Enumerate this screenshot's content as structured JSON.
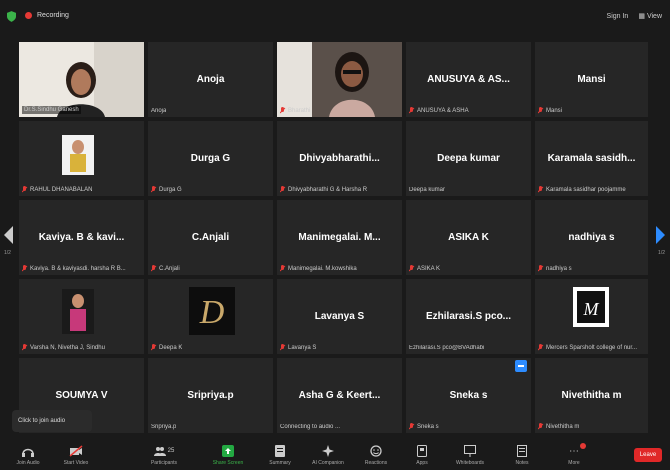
{
  "header": {
    "recording_label": "Recording",
    "signin": "Sign In",
    "view": "View"
  },
  "tiles": [
    {
      "name": "",
      "label": "Dr.S.Sindhu Ganesh"
    },
    {
      "name": "Anoja",
      "label": "Anoja"
    },
    {
      "name": "",
      "label": "Bharathi"
    },
    {
      "name": "ANUSUYA & AS...",
      "label": "ANUSUYA & ASHA"
    },
    {
      "name": "Mansi",
      "label": "Mansi"
    },
    {
      "name": "",
      "label": "RAHUL DHANABALAN"
    },
    {
      "name": "Durga G",
      "label": "Durga G"
    },
    {
      "name": "Dhivyabharathi...",
      "label": "Dhivyabharathi G & Harsha R"
    },
    {
      "name": "Deepa kumar",
      "label": "Deepa kumar"
    },
    {
      "name": "Karamala sasidh...",
      "label": "Karamala sasidhar poojamme"
    },
    {
      "name": "Kaviya. B & kavi...",
      "label": "Kaviya. B & kaviyasdi. harsha R B..."
    },
    {
      "name": "C.Anjali",
      "label": "C.Anjali"
    },
    {
      "name": "Manimegalai. M...",
      "label": "Manimegalai. M.kowshika"
    },
    {
      "name": "ASIKA K",
      "label": "ASIKA K"
    },
    {
      "name": "nadhiya s",
      "label": "nadhiya s"
    },
    {
      "name": "",
      "label": "Varsha N, Nivetha J, Sindhu"
    },
    {
      "name": "",
      "label": "Deepa K"
    },
    {
      "name": "Lavanya S",
      "label": "Lavanya S"
    },
    {
      "name": "Ezhilarasi.S pco...",
      "label": "Ezhilarasi.S pco@BVAdhabi"
    },
    {
      "name": "",
      "label": "Mercers Sparsholt college of nur..."
    },
    {
      "name": "SOUMYA V",
      "label": ""
    },
    {
      "name": "Sripriya.p",
      "label": "Sripriya.p"
    },
    {
      "name": "Asha G & Keert...",
      "label": "Connecting to audio ..."
    },
    {
      "name": "Sneka s",
      "label": "Sneka s"
    },
    {
      "name": "Nivethitha m",
      "label": "Nivethitha m"
    }
  ],
  "paging": {
    "left": "1/2",
    "right": "1/2"
  },
  "join_audio_popup": "Click to join audio",
  "toolbar": {
    "join_audio": "Join Audio",
    "start_video": "Start Video",
    "participants": "Participants",
    "participants_count": "25",
    "share_screen": "Share Screen",
    "summary": "Summary",
    "ai_companion": "AI Companion",
    "reactions": "Reactions",
    "apps": "Apps",
    "whiteboards": "Whiteboards",
    "notes": "Notes",
    "more": "More",
    "leave": "Leave"
  },
  "colors": {
    "active_speaker": "#a3d65c",
    "leave": "#e02828",
    "accent": "#2d8cff"
  }
}
